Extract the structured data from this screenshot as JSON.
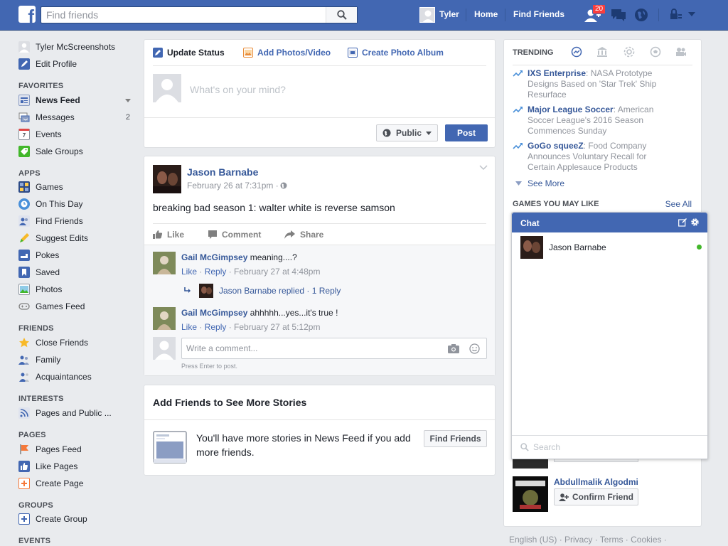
{
  "topbar": {
    "logo": "f",
    "search_placeholder": "Find friends",
    "user_name": "Tyler",
    "home": "Home",
    "find_friends": "Find Friends",
    "friend_request_count": "20"
  },
  "left_nav": {
    "profile_name": "Tyler McScreenshots",
    "edit_profile": "Edit Profile",
    "sections": {
      "favorites": "FAVORITES",
      "apps": "APPS",
      "friends": "FRIENDS",
      "interests": "INTERESTS",
      "pages": "PAGES",
      "groups": "GROUPS",
      "events": "EVENTS"
    },
    "favorites": [
      {
        "label": "News Feed",
        "icon": "news-feed-icon"
      },
      {
        "label": "Messages",
        "icon": "messages-icon",
        "count": "2"
      },
      {
        "label": "Events",
        "icon": "calendar-icon",
        "cal_day": "7"
      },
      {
        "label": "Sale Groups",
        "icon": "price-tag-icon"
      }
    ],
    "apps": [
      {
        "label": "Games",
        "icon": "games-icon"
      },
      {
        "label": "On This Day",
        "icon": "clock-icon"
      },
      {
        "label": "Find Friends",
        "icon": "find-friends-icon"
      },
      {
        "label": "Suggest Edits",
        "icon": "pencil-icon"
      },
      {
        "label": "Pokes",
        "icon": "poke-icon"
      },
      {
        "label": "Saved",
        "icon": "bookmark-icon"
      },
      {
        "label": "Photos",
        "icon": "photos-icon"
      },
      {
        "label": "Games Feed",
        "icon": "gamepad-icon"
      }
    ],
    "friends": [
      {
        "label": "Close Friends",
        "icon": "star-icon"
      },
      {
        "label": "Family",
        "icon": "family-icon"
      },
      {
        "label": "Acquaintances",
        "icon": "acquaintances-icon"
      }
    ],
    "interests": [
      {
        "label": "Pages and Public ...",
        "icon": "rss-icon"
      }
    ],
    "pages": [
      {
        "label": "Pages Feed",
        "icon": "flag-icon"
      },
      {
        "label": "Like Pages",
        "icon": "thumbs-up-icon"
      },
      {
        "label": "Create Page",
        "icon": "plus-icon"
      }
    ],
    "groups": [
      {
        "label": "Create Group",
        "icon": "plus-icon"
      }
    ]
  },
  "composer": {
    "update_status": "Update Status",
    "add_photos": "Add Photos/Video",
    "create_album": "Create Photo Album",
    "placeholder": "What's on your mind?",
    "audience": "Public",
    "post": "Post"
  },
  "post": {
    "author": "Jason Barnabe",
    "time": "February 26 at 7:31pm · ",
    "text": "breaking bad season 1: walter white is reverse samson",
    "like": "Like",
    "comment": "Comment",
    "share": "Share",
    "comments": [
      {
        "author": "Gail McGimpsey",
        "text": " meaning....?",
        "like": "Like",
        "reply": "Reply",
        "time": "February 27 at 4:48pm"
      },
      {
        "author": "Gail McGimpsey",
        "text": " ahhhhh...yes...it's true !",
        "like": "Like",
        "reply": "Reply",
        "time": "February 27 at 5:12pm"
      }
    ],
    "reply_summary": "Jason Barnabe replied · 1 Reply",
    "comment_placeholder": "Write a comment...",
    "press_enter": "Press Enter to post."
  },
  "add_friends": {
    "title": "Add Friends to See More Stories",
    "text": "You'll have more stories in News Feed if you add more friends.",
    "button": "Find Friends"
  },
  "trending": {
    "title": "TRENDING",
    "items": [
      {
        "name": "IXS Enterprise",
        "desc": ": NASA Prototype Designs Based on 'Star Trek' Ship Resurface"
      },
      {
        "name": "Major League Soccer",
        "desc": ": American Soccer League's 2016 Season Commences Sunday"
      },
      {
        "name": "GoGo squeeZ",
        "desc": ": Food Company Announces Voluntary Recall for Certain Applesauce Products"
      }
    ],
    "see_more": "See More"
  },
  "games": {
    "title": "GAMES YOU MAY LIKE",
    "see_all": "See All"
  },
  "suggestion": {
    "name": "Abdullmalik Algodmi",
    "button": "Confirm Friend"
  },
  "footer": "English (US) · Privacy · Terms · Cookies ·",
  "chat": {
    "title": "Chat",
    "contacts": [
      {
        "name": "Jason Barnabe",
        "online": true
      }
    ],
    "search_placeholder": "Search"
  },
  "colors": {
    "brand_blue": "#4267b2",
    "link_blue": "#365899",
    "badge_red": "#fa3e3e",
    "online_green": "#42b72a"
  }
}
